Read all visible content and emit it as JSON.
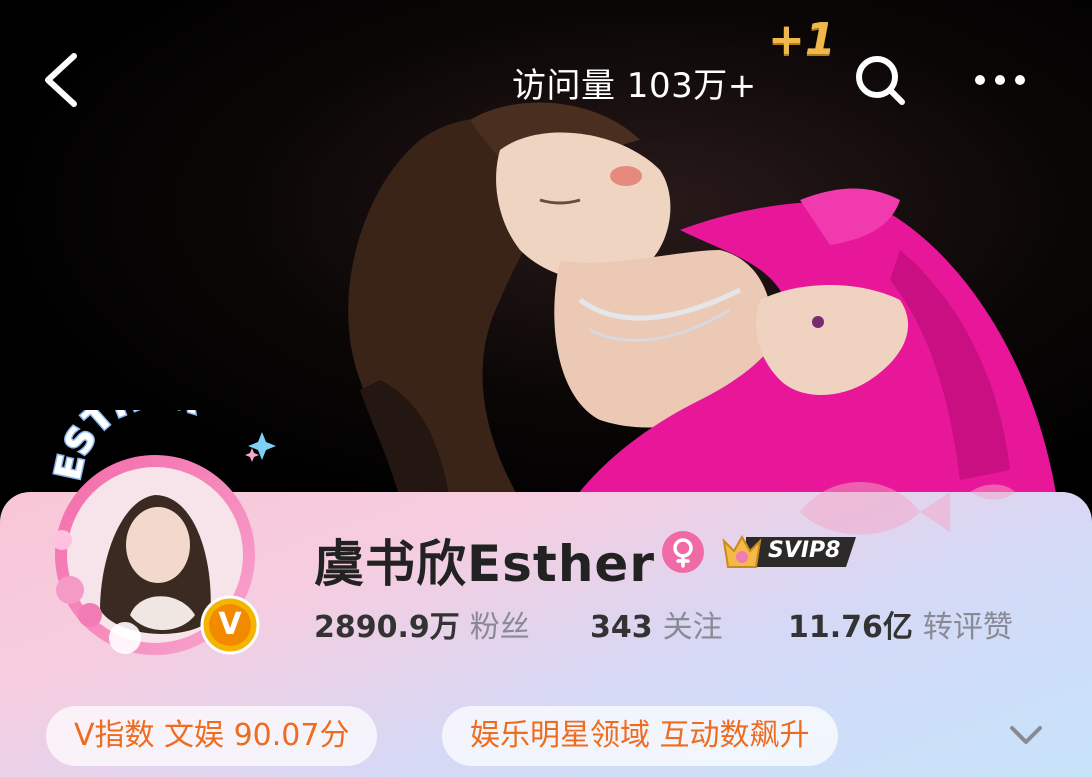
{
  "header": {
    "visits_label": "访问量 103万+",
    "visits_increment": "+1"
  },
  "avatar": {
    "badge_text": "ESTHER",
    "verified_letter": "V"
  },
  "profile": {
    "name": "虞书欣Esther",
    "gender_symbol": "♀",
    "vip_label": "SVIP8",
    "stats": [
      {
        "value": "2890.9万",
        "label": "粉丝"
      },
      {
        "value": "343",
        "label": "关注"
      },
      {
        "value": "11.76亿",
        "label": "转评赞"
      }
    ]
  },
  "chips": [
    {
      "text": "V指数 文娱 90.07分"
    },
    {
      "text": "娱乐明星领域 互动数飙升"
    }
  ],
  "colors": {
    "accent_orange": "#ef6c1f",
    "gender_pink": "#f06aa6",
    "gold": "#f0b84a",
    "dress_pink": "#e8179a"
  },
  "icons": {
    "back": "chevron-left-icon",
    "search": "search-icon",
    "more": "more-dots-icon",
    "expand": "chevron-down-icon"
  }
}
